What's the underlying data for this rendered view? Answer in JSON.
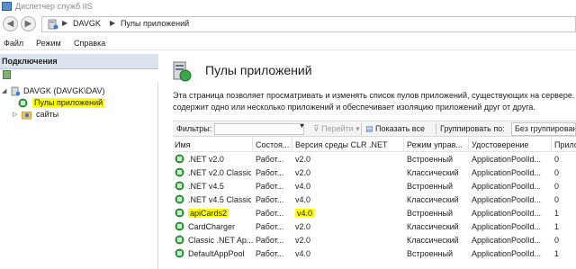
{
  "window": {
    "title": "Диспетчер служб IIS"
  },
  "address": {
    "crumbs": [
      "DAVGK",
      "Пулы приложений"
    ]
  },
  "menu": [
    "Файл",
    "Режим",
    "Справка"
  ],
  "connections": {
    "header": "Подключения",
    "server": "DAVGK (DAVGK\\DAV)",
    "items": [
      "Пулы приложений",
      "сайты"
    ]
  },
  "main": {
    "title": "Пулы приложений",
    "description_lines": [
      "Эта страница позволяет просматривать и изменять список пулов приложений, существующих на сервере. К",
      "содержит одно или несколько приложений и обеспечивает изоляцию приложений друг от друга."
    ]
  },
  "filter": {
    "label": "Фильтры:",
    "go": "Перейти",
    "show_all": "Показать все",
    "group_by_label": "Группировать по:",
    "group_by_value": "Без группирования"
  },
  "table": {
    "columns": [
      "Имя",
      "Состоя...",
      "Версия среды CLR .NET",
      "Режим управ...",
      "Удостоверение",
      "Прило"
    ],
    "rows": [
      [
        ".NET v2.0",
        "Работ...",
        "v2.0",
        "Встроенный",
        "ApplicationPoolId...",
        "0"
      ],
      [
        ".NET v2.0 Classic",
        "Работ...",
        "v2.0",
        "Классический",
        "ApplicationPoolId...",
        "0"
      ],
      [
        ".NET v4.5",
        "Работ...",
        "v4.0",
        "Встроенный",
        "ApplicationPoolId...",
        "0"
      ],
      [
        ".NET v4.5 Classic",
        "Работ...",
        "v4.0",
        "Классический",
        "ApplicationPoolId...",
        "0"
      ],
      [
        "apiCards2",
        "Работ...",
        "v4.0",
        "Встроенный",
        "ApplicationPoolId...",
        "1"
      ],
      [
        "CardCharger",
        "Работ...",
        "v2.0",
        "Классический",
        "ApplicationPoolId...",
        "1"
      ],
      [
        "Classic .NET Ap...",
        "Работ...",
        "v2.0",
        "Классический",
        "ApplicationPoolId...",
        "0"
      ],
      [
        "DefaultAppPool",
        "Работ...",
        "v4.0",
        "Встроенный",
        "ApplicationPoolId...",
        "1"
      ]
    ]
  },
  "colors": {
    "highlight": "#ffff00",
    "pane_header": "#dbe3ee"
  }
}
